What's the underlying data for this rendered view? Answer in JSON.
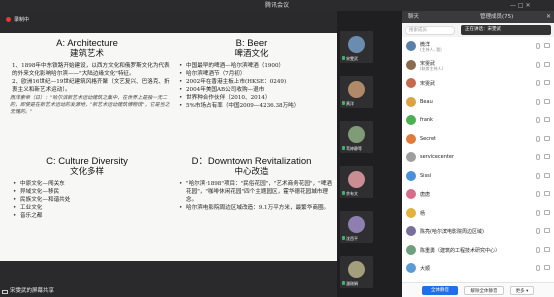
{
  "window": {
    "title": "腾讯会议",
    "controls": "—  □  ✕"
  },
  "recording": {
    "label": "录制中"
  },
  "slide": {
    "A": {
      "title": "A: Architecture",
      "subtitle": "建筑艺术",
      "items": [
        "1、1898年中东铁路开始建设，以西方文化和俄罗斯文化为代表的外来文化影响哈尔滨——\"大陆边缘文化\"特征。",
        "2、欧洲16世纪—19世纪建筑风格齐聚（文艺复兴、巴洛克、折衷主义和新艺术运动）。"
      ],
      "note": "西洋索帝（日）：\"哈尔滨新艺术运动建筑之集中，在世界上是独一无二的，即使是在新艺术运动的发源地，\"新艺术运动建筑博物馆\"，它是当之无愧的。\""
    },
    "B": {
      "title": "B: Beer",
      "subtitle": "啤酒文化",
      "items": [
        "中国最早的啤酒—哈尔滨啤酒（1900）",
        "哈尔滨啤酒节（7月初）",
        "2002年在香港主板上市(HKSE：0249)",
        "2004年美国AB公司收购—退市",
        "世界种合作伙伴（2010、2014）",
        "5%市场占有率（中国2009—4236.38万吨）"
      ]
    },
    "C": {
      "title": "C: Culture Diversity",
      "subtitle": "文化多样",
      "items": [
        "中原文化—闯关东",
        "异域文化—移民",
        "民族文化—和谐共处",
        "工业文化",
        "音乐之都"
      ]
    },
    "D": {
      "title": "D：Downtown Revitalization",
      "subtitle": "中心改造",
      "items": [
        "\"哈尔滨·1898\"项目：\"民俗花园\"，\"艺术商务花园\"，\"啤酒花园\"，\"咖啡休闲花园\"四个主题园区，霍华德花园城市理念。",
        "哈尔滨电影院周边区域改造：9.1万平方米，最繁华商圈。"
      ]
    }
  },
  "sharing": {
    "label": "宋雯武的屏幕共享"
  },
  "videos": [
    {
      "name": "宋雯武",
      "color": "#6a8caf"
    },
    {
      "name": "黄洋",
      "color": "#b08968"
    },
    {
      "name": "苇婷静等",
      "color": "#7f9c77"
    },
    {
      "name": "余有文",
      "color": "#c98d93"
    },
    {
      "name": "沈西平",
      "color": "#8e7fb0"
    },
    {
      "name": "潘刚娟",
      "color": "#a39e7c"
    }
  ],
  "panel": {
    "tab_chat": "聊天",
    "tab_members": "管理成员(75)",
    "search_placeholder": "搜索成员",
    "toast": "正在讲话：宋雯武",
    "members": [
      {
        "name": "微洋",
        "sub": "(主持人, 我)",
        "color": "#5a7fa8"
      },
      {
        "name": "宋雯武",
        "sub": "(联席主持人)",
        "color": "#8a6b4e"
      },
      {
        "name": "宋雯武",
        "sub": "",
        "color": "#c46a4e"
      },
      {
        "name": "Beau",
        "sub": "",
        "color": "#d9a441"
      },
      {
        "name": "frank",
        "sub": "",
        "color": "#4caf50"
      },
      {
        "name": "Secret",
        "sub": "",
        "color": "#e07b39"
      },
      {
        "name": "servicecenter",
        "sub": "",
        "color": "#9e9e9e"
      },
      {
        "name": "Sissi",
        "sub": "",
        "color": "#4a90d9"
      },
      {
        "name": "唐唐",
        "sub": "",
        "color": "#d86d8a"
      },
      {
        "name": "杨",
        "sub": "",
        "color": "#e3b23c"
      },
      {
        "name": "陈亮(哈尔滨电影院周边区域)",
        "sub": "",
        "color": "#7a6e9c"
      },
      {
        "name": "陈重勇（建筑的工程技术研究中心）",
        "sub": "",
        "color": "#6f9f7d"
      },
      {
        "name": "大顺",
        "sub": "",
        "color": "#5b9bd5"
      }
    ],
    "btn_mute_all": "全体静音",
    "btn_unmute_all": "解除全体静音",
    "btn_more": "更多 ▾"
  }
}
